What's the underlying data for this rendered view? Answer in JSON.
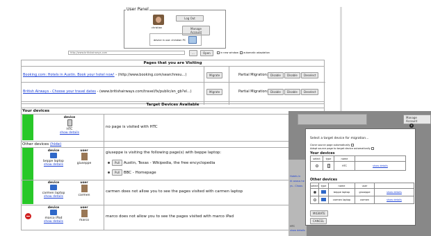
{
  "user_panel": {
    "title": "User Panel",
    "username": "christian",
    "logout_label": "Log Out",
    "manage_label": "Manage Account",
    "device_in_use": "device in use:  christian PC"
  },
  "url_bar": {
    "url": "http://www.britishairways.com",
    "dots_label": "...",
    "open_label": "Open",
    "new_window_label": "in new window",
    "auto_adapt_label": "automatic adaptation"
  },
  "pages": {
    "title": "Pages that you are Visiting",
    "rows": [
      {
        "link": "Booking.com: Hotels in Austin. Book your hotel now!",
        "url": " -  (http://www.booking.com/searchresu...)"
      },
      {
        "link": "British Airways - Choose your travel dates",
        "url": " -  (www.britishairways.com/travel/fx/public/en_gb?eI...)"
      }
    ],
    "migrate_label": "Migrate",
    "partial_label": "Partial Migration:",
    "disable_label": "Disable",
    "deselect_label": "Deselect"
  },
  "targets": {
    "title": "Target Devices Available",
    "your_devices": "Your devices",
    "device_header": "device",
    "user_header": "user",
    "show_details": "show details",
    "htc_name": "HTC",
    "htc_msg": "no page is visited with HTC",
    "other_devices": "Other devices",
    "hide_link": "(hide)",
    "beppe_device": "beppe laptop",
    "beppe_user": "giuseppe",
    "beppe_msg": "giuseppe is visiting the following page(s) with beppe laptop:",
    "pull_label": "Pull",
    "beppe_page1": "Austin, Texas - Wikipedia, the free encyclopedia",
    "beppe_page2": "BBC - Homepage",
    "carmen_device": "carmen laptop",
    "carmen_user": "carmen",
    "carmen_msg": "carmen does not allow you to see the pages visited with carmen laptop",
    "marco_device": "marco iPad",
    "marco_user": "marco",
    "marco_msg": "marco does not allow you to see the pages visited with marco iPad"
  },
  "popup": {
    "backdrop_manage": "Manage Account",
    "backdrop_lines": [
      "Hotels in",
      "ht anaus he",
      "ys - Choos",
      "HTC",
      "show details"
    ],
    "close_label": "×",
    "title": "Select a target device for migration...",
    "checkbox1": "Clone source page automatically",
    "checkbox2": "Adapt source page to target device automatically",
    "your_devices": "Your devices",
    "col_select": "select",
    "col_type": "type",
    "col_name": "name",
    "col_user": "user",
    "htc_name": "HTC",
    "show_details": "show details",
    "other_devices": "Other devices",
    "rows": [
      {
        "name": "beppe laptop",
        "user": "giuseppe"
      },
      {
        "name": "carmen laptop",
        "user": "carmen"
      }
    ],
    "migrate_label": "MIGRATE",
    "cancel_label": "CANCEL"
  }
}
